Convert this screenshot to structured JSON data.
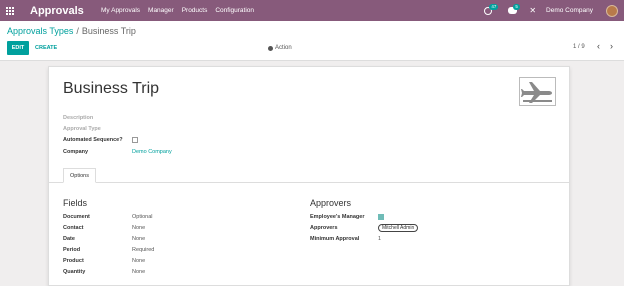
{
  "navbar": {
    "brand": "Approvals",
    "menu": [
      "My Approvals",
      "Manager",
      "Products",
      "Configuration"
    ],
    "activity_badge": "47",
    "messages_badge": "5",
    "company": "Demo Company"
  },
  "control_panel": {
    "breadcrumb_parent": "Approvals Types",
    "breadcrumb_separator": "/",
    "breadcrumb_current": "Business Trip",
    "edit_label": "EDIT",
    "create_label": "CREATE",
    "action_label": "Action",
    "pager": "1 / 9"
  },
  "form": {
    "title": "Business Trip",
    "description_label": "Description",
    "approval_type_label": "Approval Type",
    "automated_sequence_label": "Automated Sequence?",
    "company_label": "Company",
    "company_value": "Demo Company",
    "tab_label": "Options",
    "fields_title": "Fields",
    "fields": [
      {
        "label": "Document",
        "value": "Optional"
      },
      {
        "label": "Contact",
        "value": "None"
      },
      {
        "label": "Date",
        "value": "None"
      },
      {
        "label": "Period",
        "value": "Required"
      },
      {
        "label": "Product",
        "value": "None"
      },
      {
        "label": "Quantity",
        "value": "None"
      }
    ],
    "approvers_title": "Approvers",
    "employees_manager_label": "Employee's Manager",
    "approvers_label": "Approvers",
    "approvers_tag": "Mitchell Admin",
    "minimum_approval_label": "Minimum Approval",
    "minimum_approval_value": "1"
  },
  "colors": {
    "navbar": "#875a7b",
    "accent": "#00a09d"
  }
}
